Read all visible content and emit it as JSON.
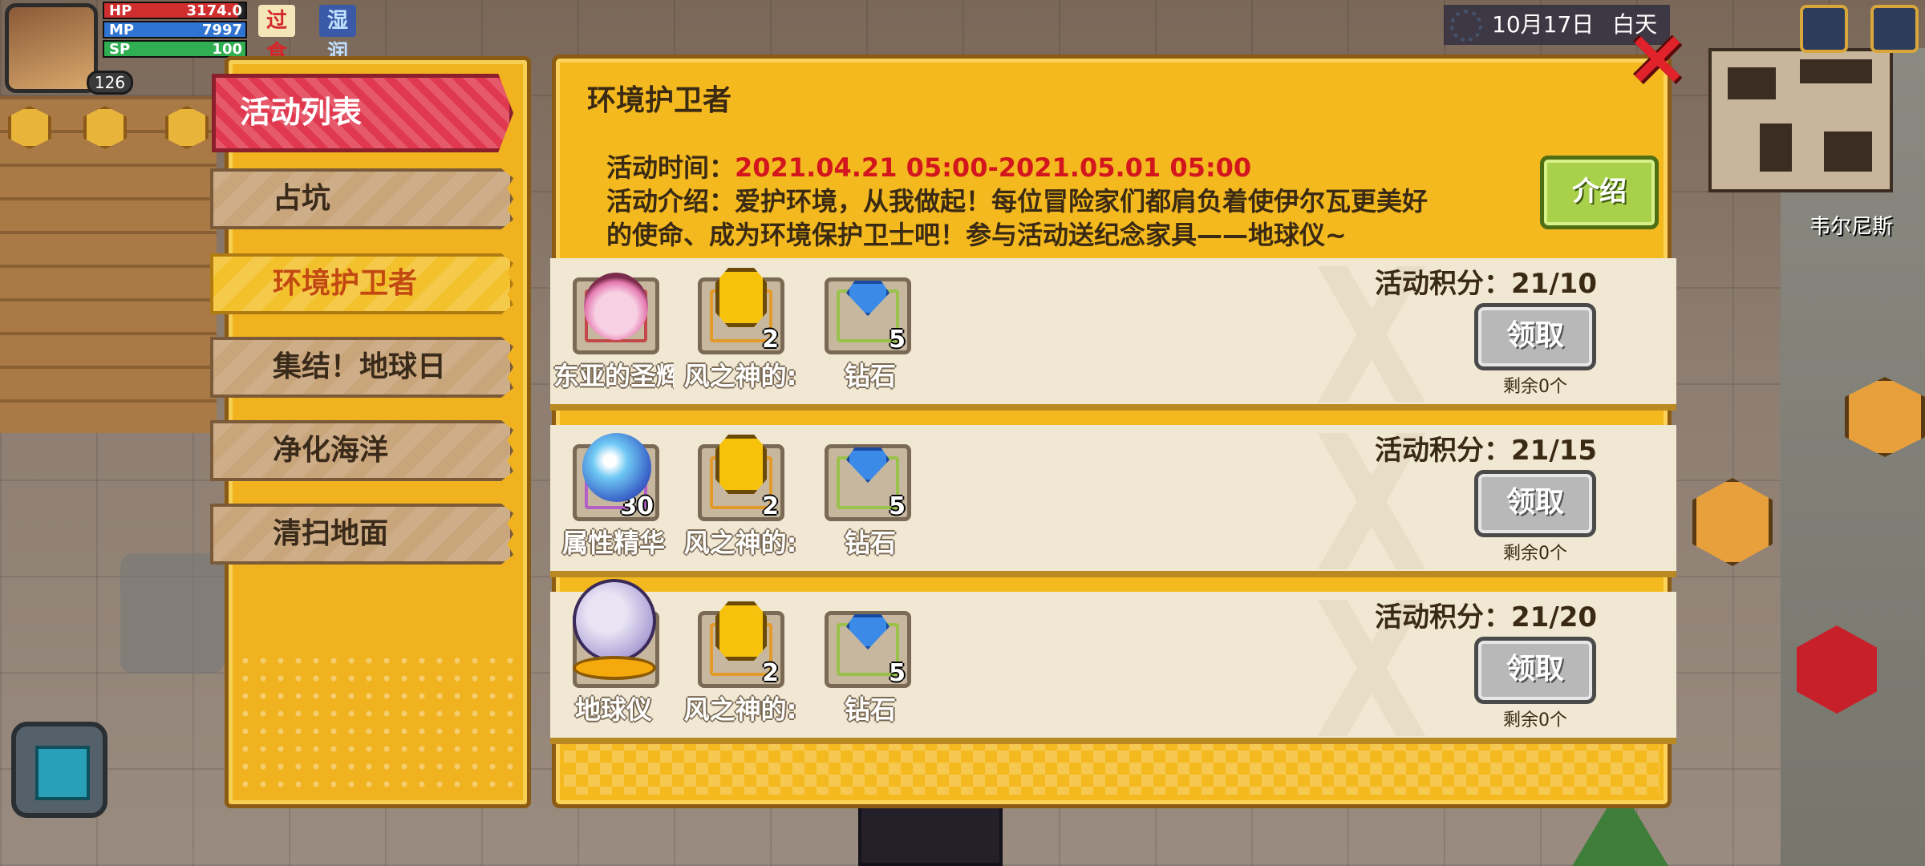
{
  "hud": {
    "hp_label": "HP",
    "hp_value": "3174.0",
    "hp_fraction": 0.95,
    "mp_label": "MP",
    "mp_value": "7997",
    "mp_fraction": 1.0,
    "sp_label": "SP",
    "sp_value": "100",
    "sp_fraction": 1.0,
    "level": "126",
    "status_overeat": "过食",
    "status_moist": "湿润",
    "date": "10月17日",
    "daytime": "白天",
    "npc_name": "韦尔尼斯"
  },
  "sidebar": {
    "header": "活动列表",
    "tabs": [
      {
        "label": "占坑"
      },
      {
        "label": "环境护卫者"
      },
      {
        "label": "集结！地球日"
      },
      {
        "label": "净化海洋"
      },
      {
        "label": "清扫地面"
      }
    ],
    "active_index": 1
  },
  "event": {
    "title": "环境护卫者",
    "time_label": "活动时间：",
    "time_value": "2021.04.21 05:00-2021.05.01 05:00",
    "intro_line1": "活动介绍：爱护环境，从我做起！每位冒险家们都肩负着使伊尔瓦更美好",
    "intro_line2": "的使命、成为环境保护卫士吧！参与活动送纪念家具——地球仪~",
    "intro_button": "介绍"
  },
  "rewards": [
    {
      "score": "活动积分：21/10",
      "claim_label": "领取",
      "remaining": "剩余0个",
      "items": [
        {
          "name": "东亚的圣辉",
          "count": "",
          "icon": "potion-icon"
        },
        {
          "name": "风之神的:",
          "count": "2",
          "icon": "gold-medal-icon"
        },
        {
          "name": "钻石",
          "count": "5",
          "icon": "diamond-icon"
        }
      ]
    },
    {
      "score": "活动积分：21/15",
      "claim_label": "领取",
      "remaining": "剩余0个",
      "items": [
        {
          "name": "属性精华",
          "count": "30",
          "icon": "orb-icon"
        },
        {
          "name": "风之神的:",
          "count": "2",
          "icon": "gold-medal-icon"
        },
        {
          "name": "钻石",
          "count": "5",
          "icon": "diamond-icon"
        }
      ]
    },
    {
      "score": "活动积分：21/20",
      "claim_label": "领取",
      "remaining": "剩余0个",
      "items": [
        {
          "name": "地球仪",
          "count": "",
          "icon": "globe-icon"
        },
        {
          "name": "风之神的:",
          "count": "2",
          "icon": "gold-medal-icon"
        },
        {
          "name": "钻石",
          "count": "5",
          "icon": "diamond-icon"
        }
      ]
    }
  ],
  "colors": {
    "panel": "#f4b91f",
    "active_header": "#e0394f",
    "time_red": "#d3161d",
    "intro_green": "#a8d04a",
    "claim_gray": "#b8b8b8"
  }
}
